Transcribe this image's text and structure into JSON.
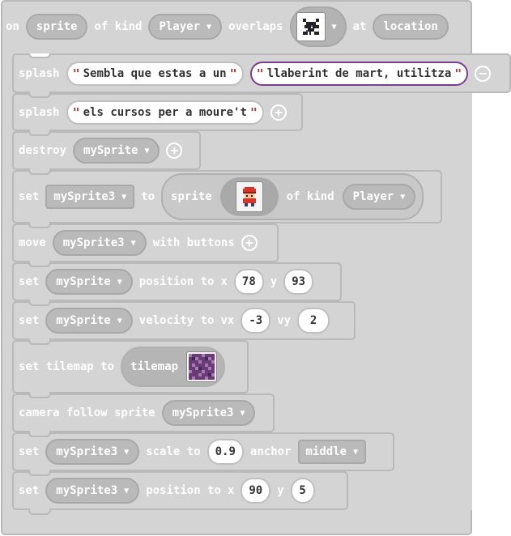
{
  "event": {
    "on": "on",
    "sprite_param": "sprite",
    "of_kind": "of kind",
    "kind_value": "Player",
    "overlaps": "overlaps",
    "at": "at",
    "location_param": "location",
    "tile_icon": "tile-image-icon"
  },
  "statements": {
    "splash1": {
      "keyword": "splash",
      "text1": "Sembla que estas a un",
      "text2": "llaberint de mart, utilitza"
    },
    "splash2": {
      "keyword": "splash",
      "text1": "els cursos per a moure't"
    },
    "destroy": {
      "keyword": "destroy",
      "var": "mySprite"
    },
    "set_sprite": {
      "set": "set",
      "var": "mySprite3",
      "to": "to",
      "sprite": "sprite",
      "of_kind": "of kind",
      "kind": "Player"
    },
    "move": {
      "keyword": "move",
      "var": "mySprite3",
      "with_buttons": "with buttons"
    },
    "set_position": {
      "set": "set",
      "var": "mySprite",
      "position_to": "position to",
      "x": "x",
      "x_value": "78",
      "y": "y",
      "y_value": "93"
    },
    "set_velocity": {
      "set": "set",
      "var": "mySprite",
      "velocity_to": "velocity to",
      "vx": "vx",
      "vx_value": "-3",
      "vy": "vy",
      "vy_value": "2"
    },
    "set_tilemap": {
      "label": "set tilemap to",
      "tilemap": "tilemap"
    },
    "camera": {
      "label": "camera follow sprite",
      "var": "mySprite3"
    },
    "set_scale": {
      "set": "set",
      "var": "mySprite3",
      "scale_to": "scale to",
      "scale_value": "0.9",
      "anchor": "anchor",
      "anchor_value": "middle"
    },
    "set_position2": {
      "set": "set",
      "var": "mySprite3",
      "position_to": "position to",
      "x": "x",
      "x_value": "90",
      "y": "y",
      "y_value": "5"
    }
  },
  "glyphs": {
    "dropdown": "▼",
    "quote": "\"",
    "plus": "+",
    "minus": "−"
  },
  "colors": {
    "block": "#d4d4d4",
    "border": "#b9b9b9",
    "input": "#ffffff",
    "quote": "#b43a3a",
    "active_border": "#7a3e8f"
  }
}
